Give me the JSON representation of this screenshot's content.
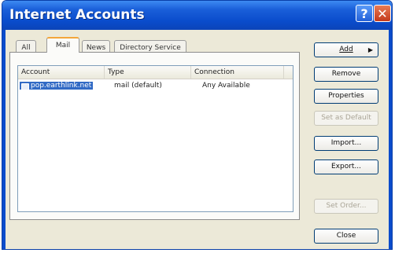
{
  "window": {
    "title": "Internet Accounts"
  },
  "tabs": [
    {
      "label": "All",
      "active": false
    },
    {
      "label": "Mail",
      "active": true
    },
    {
      "label": "News",
      "active": false
    },
    {
      "label": "Directory Service",
      "active": false
    }
  ],
  "list": {
    "columns": [
      "Account",
      "Type",
      "Connection"
    ],
    "rows": [
      {
        "account": "pop.earthlink.net",
        "type": "mail (default)",
        "connection": "Any Available",
        "selected": true
      }
    ]
  },
  "buttons": {
    "add": "Add",
    "remove": "Remove",
    "properties": "Properties",
    "set_default": "Set as Default",
    "import": "Import...",
    "export": "Export...",
    "set_order": "Set Order...",
    "close": "Close"
  },
  "colors": {
    "titlebar": "#0a4ccc",
    "selection": "#316ac5",
    "dialog": "#ece9d8"
  }
}
